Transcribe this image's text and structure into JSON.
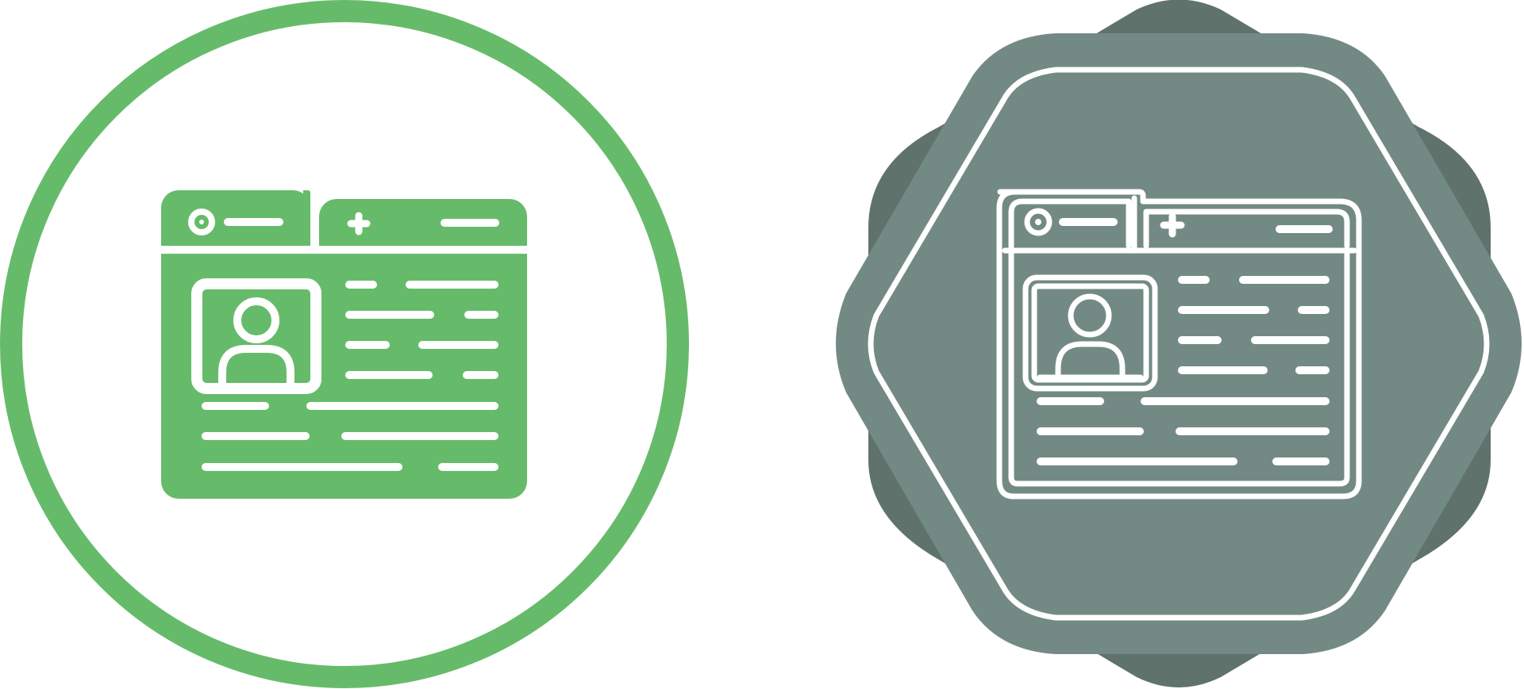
{
  "icons": [
    {
      "name": "profile-browser-icon",
      "style": "glyph",
      "badge_shape": "circle",
      "colors": {
        "ring": "#66BB6A",
        "badge_fill": "#FFFFFF",
        "window_fill": "#66BB6A",
        "detail": "#FFFFFF"
      }
    },
    {
      "name": "profile-browser-icon",
      "style": "line",
      "badge_shape": "octagon-star",
      "colors": {
        "back_shape": "#5F726C",
        "front_shape": "#738A84",
        "outline": "#FFFFFF"
      }
    }
  ]
}
